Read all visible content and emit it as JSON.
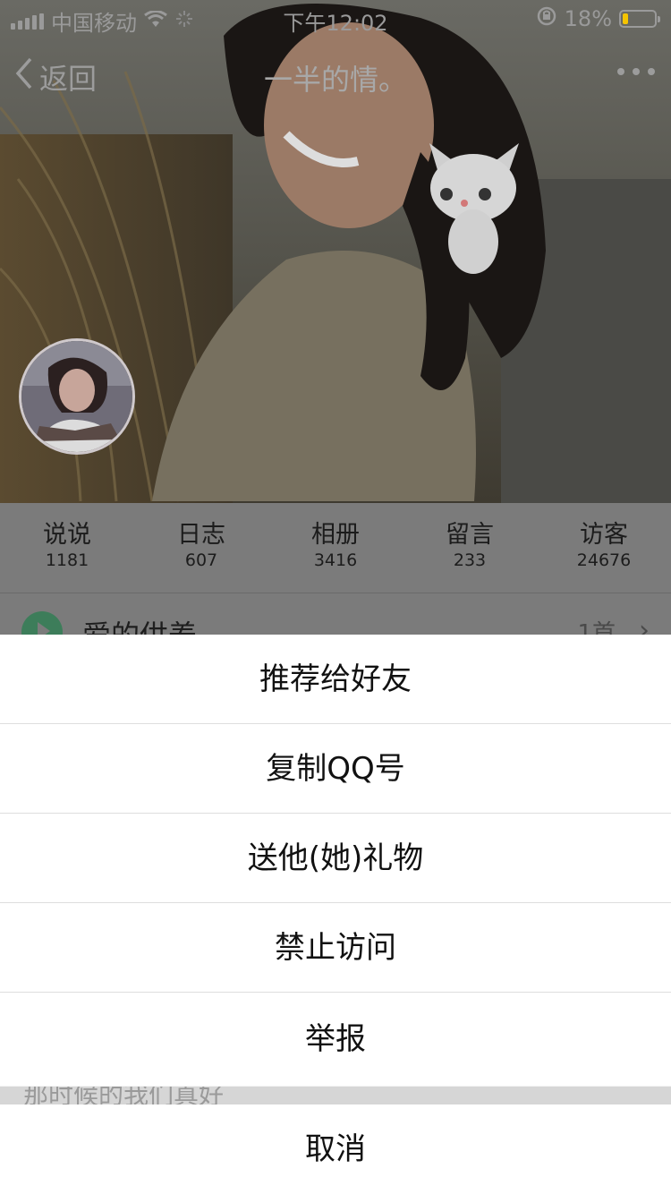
{
  "status_bar": {
    "carrier": "中国移动",
    "time": "下午12:02",
    "battery_text": "18%",
    "battery_level": 0.18,
    "battery_color": "#f5c400"
  },
  "nav": {
    "back_label": "返回",
    "title": "一半的情。",
    "more_icon": "more-dots-icon"
  },
  "stats": [
    {
      "label": "说说",
      "value": "1181"
    },
    {
      "label": "日志",
      "value": "607"
    },
    {
      "label": "相册",
      "value": "3416"
    },
    {
      "label": "留言",
      "value": "233"
    },
    {
      "label": "访客",
      "value": "24676"
    }
  ],
  "music_row": {
    "title": "爱的供养",
    "count": "1首"
  },
  "action_sheet": {
    "items": [
      {
        "label": "推荐给好友"
      },
      {
        "label": "复制QQ号"
      },
      {
        "label": "送他(她)礼物"
      },
      {
        "label": "禁止访问"
      },
      {
        "label": "举报"
      }
    ],
    "background_text": "那时候的我们真好",
    "cancel_label": "取消"
  }
}
